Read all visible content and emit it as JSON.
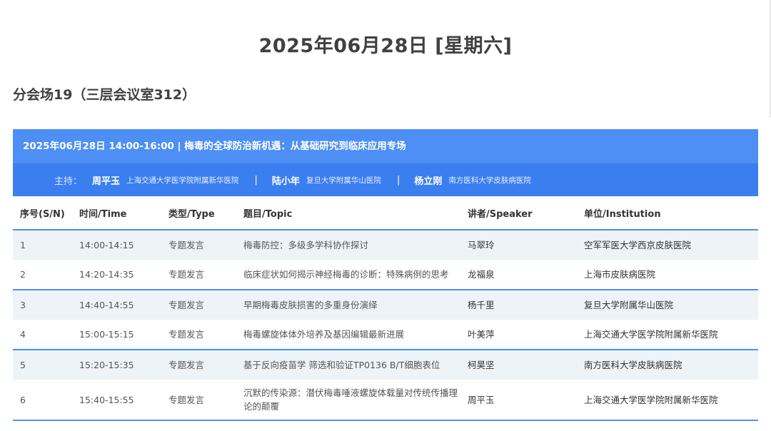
{
  "page_title": "2025年06月28日 [星期六]",
  "venue": "分会场19（三层会议室312）",
  "session": {
    "title": "2025年06月28日 14:00-16:00 | 梅毒的全球防治新机遇：从基础研究到临床应用专场",
    "hosts_label": "主持：",
    "separator": "|",
    "hosts": [
      {
        "name": "周平玉",
        "org": "上海交通大学医学院附属新华医院"
      },
      {
        "name": "陆小年",
        "org": "复旦大学附属华山医院"
      },
      {
        "name": "杨立刚",
        "org": "南方医科大学皮肤病医院"
      }
    ]
  },
  "table": {
    "headers": [
      "序号(S/N)",
      "时间/Time",
      "类型/Type",
      "题目/Topic",
      "讲者/Speaker",
      "单位/Institution"
    ],
    "rows": [
      {
        "sn": "1",
        "time": "14:00-14:15",
        "type": "专题发言",
        "topic": "梅毒防控：多级多学科协作探讨",
        "speaker": "马翠玲",
        "institution": "空军军医大学西京皮肤医院"
      },
      {
        "sn": "2",
        "time": "14:20-14:35",
        "type": "专题发言",
        "topic": "临床症状如何揭示神经梅毒的诊断：特殊病例的思考",
        "speaker": "龙福泉",
        "institution": "上海市皮肤病医院"
      },
      {
        "sn": "3",
        "time": "14:40-14:55",
        "type": "专题发言",
        "topic": "早期梅毒皮肤损害的多重身份演绎",
        "speaker": "杨千里",
        "institution": "复旦大学附属华山医院"
      },
      {
        "sn": "4",
        "time": "15:00-15:15",
        "type": "专题发言",
        "topic": "梅毒螺旋体体外培养及基因编辑最新进展",
        "speaker": "叶美萍",
        "institution": "上海交通大学医学院附属新华医院"
      },
      {
        "sn": "5",
        "time": "15:20-15:35",
        "type": "专题发言",
        "topic": "基于反向疫苗学 筛选和验证TP0136 B/T细胞表位",
        "speaker": "柯昊坚",
        "institution": "南方医科大学皮肤病医院"
      },
      {
        "sn": "6",
        "time": "15:40-15:55",
        "type": "专题发言",
        "topic": "沉默的传染源：潜伏梅毒唾液螺旋体载量对传统传播理论的颠覆",
        "speaker": "周平玉",
        "institution": "上海交通大学医学院附属新华医院"
      }
    ]
  }
}
